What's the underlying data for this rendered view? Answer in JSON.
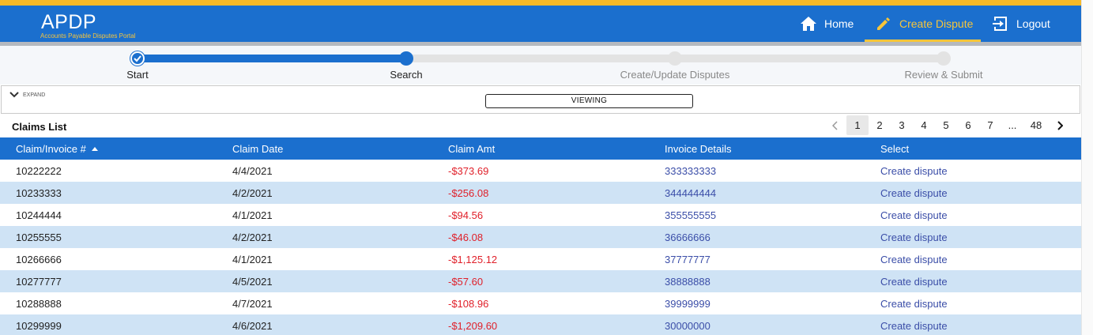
{
  "app": {
    "title": "APDP",
    "subtitle": "Accounts Payable Disputes Portal"
  },
  "nav": {
    "home": "Home",
    "create_dispute": "Create Dispute",
    "logout": "Logout"
  },
  "stepper": {
    "steps": [
      "Start",
      "Search",
      "Create/Update Disputes",
      "Review & Submit"
    ],
    "completed_steps": 1,
    "active_step": 2
  },
  "filter": {
    "expand_label": "EXPAND",
    "viewing_label": "VIEWING"
  },
  "claims": {
    "title": "Claims List",
    "pagination": {
      "pages": [
        "1",
        "2",
        "3",
        "4",
        "5",
        "6",
        "7",
        "...",
        "48"
      ],
      "current": "1"
    },
    "columns": [
      "Claim/Invoice #",
      "Claim Date",
      "Claim Amt",
      "Invoice Details",
      "Select"
    ],
    "rows": [
      {
        "claim": "10222222",
        "date": "4/4/2021",
        "amount": "-$373.69",
        "invoice": "333333333",
        "action": "Create dispute"
      },
      {
        "claim": "10233333",
        "date": "4/2/2021",
        "amount": "-$256.08",
        "invoice": "344444444",
        "action": "Create dispute"
      },
      {
        "claim": "10244444",
        "date": "4/1/2021",
        "amount": "-$94.56",
        "invoice": "355555555",
        "action": "Create dispute"
      },
      {
        "claim": "10255555",
        "date": "4/2/2021",
        "amount": "-$46.08",
        "invoice": "36666666",
        "action": "Create dispute"
      },
      {
        "claim": "10266666",
        "date": "4/1/2021",
        "amount": "-$1,125.12",
        "invoice": "37777777",
        "action": "Create dispute"
      },
      {
        "claim": "10277777",
        "date": "4/5/2021",
        "amount": "-$57.60",
        "invoice": "38888888",
        "action": "Create dispute"
      },
      {
        "claim": "10288888",
        "date": "4/7/2021",
        "amount": "-$108.96",
        "invoice": "39999999",
        "action": "Create dispute"
      },
      {
        "claim": "10299999",
        "date": "4/6/2021",
        "amount": "-$1,209.60",
        "invoice": "30000000",
        "action": "Create dispute"
      }
    ]
  },
  "colors": {
    "brand_blue": "#1b6fce",
    "accent_yellow": "#f7b928",
    "row_alt": "#cfe3f5",
    "negative_amount": "#e0202a",
    "link": "#3b4ea8"
  },
  "icons": {
    "home": "home-icon",
    "create": "pencil-icon",
    "logout": "logout-icon",
    "expand": "chevron-down-icon",
    "check": "check-icon",
    "prev": "chevron-left-icon",
    "next": "chevron-right-icon",
    "sort": "sort-ascending-icon"
  }
}
